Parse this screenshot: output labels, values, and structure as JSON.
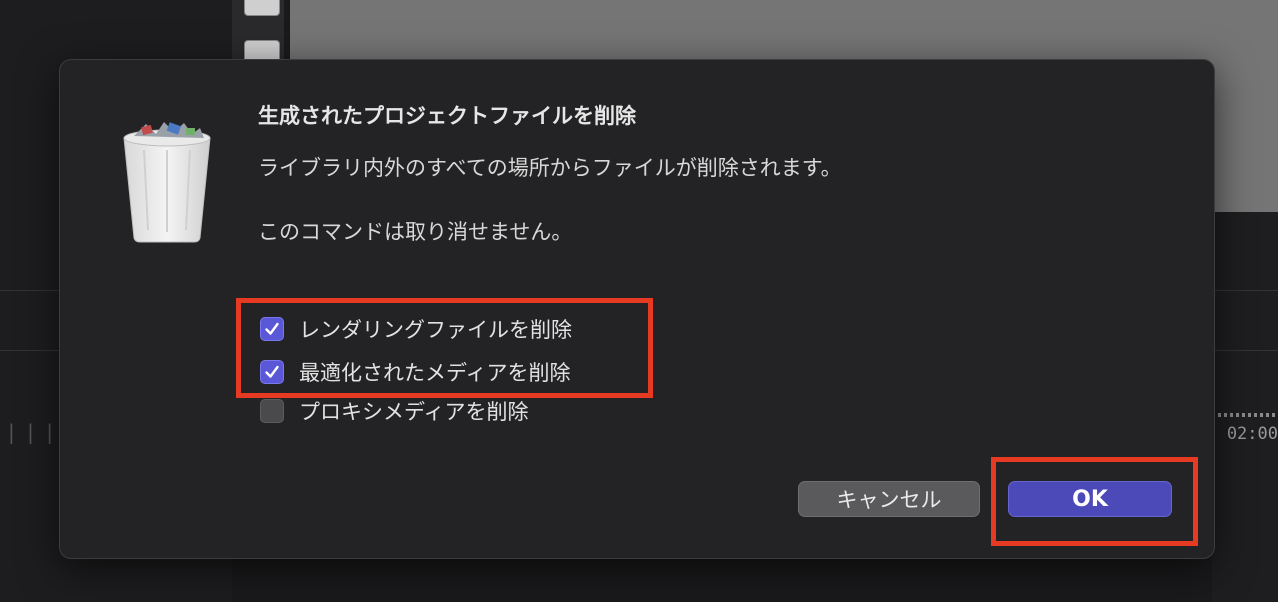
{
  "dialog": {
    "title": "生成されたプロジェクトファイルを削除",
    "message": "ライブラリ内外のすべての場所からファイルが削除されます。",
    "warning": "このコマンドは取り消せません。",
    "options": [
      {
        "label": "レンダリングファイルを削除",
        "checked": true
      },
      {
        "label": "最適化されたメディアを削除",
        "checked": true
      },
      {
        "label": "プロキシメディアを削除",
        "checked": false
      }
    ],
    "cancel_label": "キャンセル",
    "ok_label": "OK"
  },
  "background": {
    "timecode": "02:00"
  },
  "colors": {
    "accent": "#5a58d6",
    "ok_button": "#4c49b8",
    "highlight": "#e63a22"
  },
  "icons": {
    "dialog_icon": "trash-icon",
    "check": "checkmark-icon"
  }
}
